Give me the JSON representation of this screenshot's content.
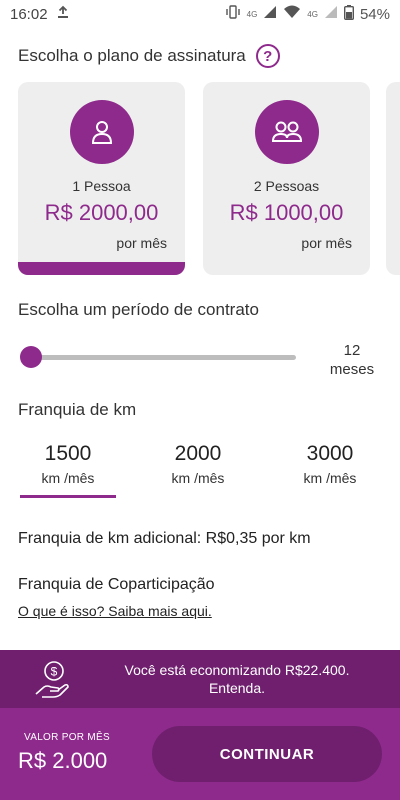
{
  "status_bar": {
    "time": "16:02",
    "network_label": "4G",
    "network_label_secondary": "4G",
    "battery": "54%"
  },
  "plan_section": {
    "heading": "Escolha o plano de assinatura",
    "help_icon": "question-circle-icon",
    "plans": [
      {
        "name": "1 Pessoa",
        "price": "R$ 2000,00",
        "period": "por mês",
        "icon": "person-icon",
        "selected": true
      },
      {
        "name": "2 Pessoas",
        "price": "R$ 1000,00",
        "period": "por mês",
        "icon": "people-icon",
        "selected": false
      }
    ]
  },
  "contract": {
    "heading": "Escolha um período de contrato",
    "value_number": "12",
    "value_unit": "meses"
  },
  "km": {
    "heading": "Franquia de km",
    "options": [
      {
        "value": "1500",
        "unit": "km /mês",
        "selected": true
      },
      {
        "value": "2000",
        "unit": "km /mês",
        "selected": false
      },
      {
        "value": "3000",
        "unit": "km /mês",
        "selected": false
      }
    ],
    "extra": "Franquia de km adicional: R$0,35 por km"
  },
  "copart": {
    "heading": "Franquia de Coparticipação",
    "link": "O que é isso? Saiba mais aqui."
  },
  "savings": {
    "line1": "Você está economizando R$22.400.",
    "line2": "Entenda.",
    "icon": "money-hand-icon"
  },
  "footer": {
    "total_label": "VALOR POR MÊS",
    "total_value": "R$ 2.000",
    "continue_label": "CONTINUAR"
  },
  "colors": {
    "accent": "#8e2a8c",
    "accent_dark": "#6f1f6e",
    "card_bg": "#eeeeee"
  }
}
